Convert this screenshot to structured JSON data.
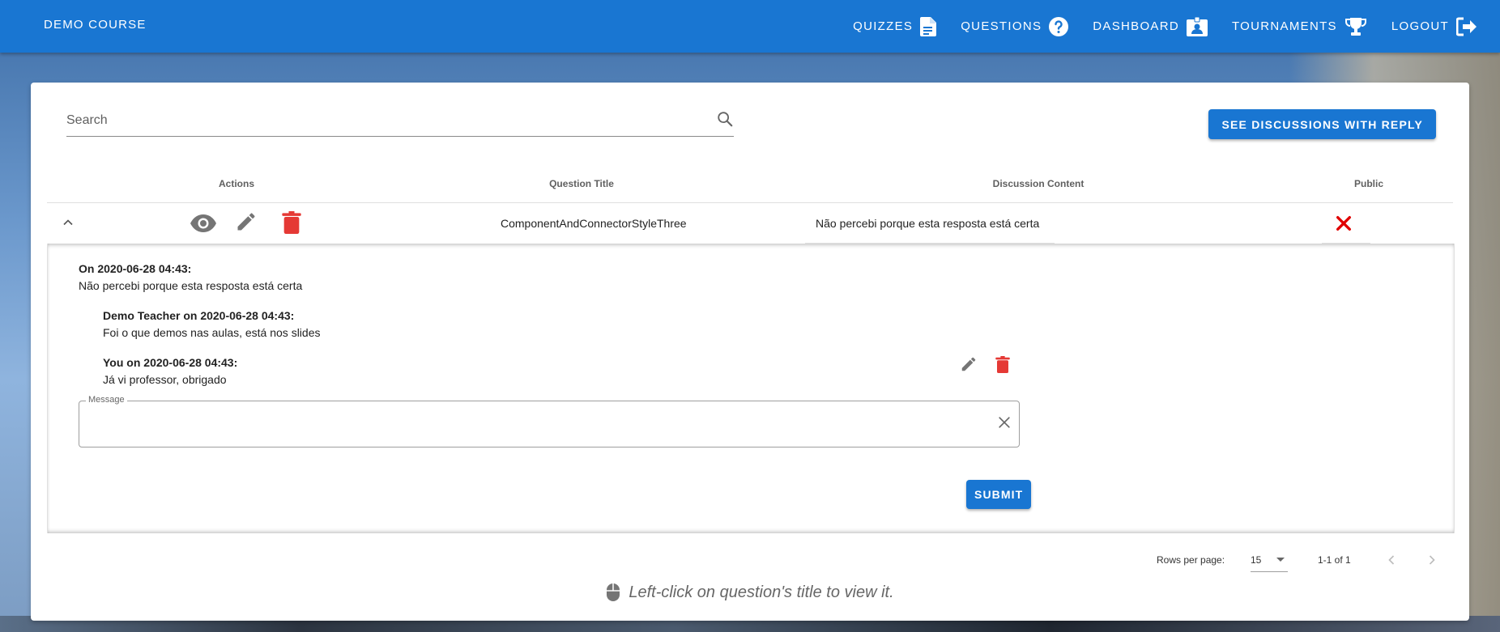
{
  "app": {
    "course_title": "DEMO COURSE"
  },
  "nav": [
    {
      "label": "QUIZZES",
      "icon": "file-document-icon"
    },
    {
      "label": "QUESTIONS",
      "icon": "help-circle-icon"
    },
    {
      "label": "DASHBOARD",
      "icon": "id-card-icon"
    },
    {
      "label": "TOURNAMENTS",
      "icon": "trophy-icon"
    },
    {
      "label": "LOGOUT",
      "icon": "logout-icon"
    }
  ],
  "search": {
    "placeholder": "Search",
    "value": ""
  },
  "see_discussions_button": "SEE DISCUSSIONS WITH REPLY",
  "table": {
    "headers": [
      "Actions",
      "Question Title",
      "Discussion Content",
      "Public"
    ],
    "rows": [
      {
        "question_title": "ComponentAndConnectorStyleThree",
        "discussion_content": "Não percebi porque esta resposta está certa",
        "public": false
      }
    ]
  },
  "discussion": {
    "messages": [
      {
        "author": "On 2020-06-28 04:43:",
        "text": "Não percebi porque esta resposta está certa"
      },
      {
        "author": "Demo Teacher on 2020-06-28 04:43:",
        "text": "Foi o que demos nas aulas, está nos slides"
      },
      {
        "author": "You on 2020-06-28 04:43:",
        "text": "Já vi professor, obrigado"
      }
    ],
    "message_field": {
      "label": "Message",
      "value": ""
    },
    "submit_label": "SUBMIT"
  },
  "pagination": {
    "rows_per_page_label": "Rows per page:",
    "rows_per_page_value": "15",
    "range_text": "1-1 of 1"
  },
  "tip": "Left-click on question's title to view it.",
  "colors": {
    "primary": "#1976d2",
    "danger": "#e53935",
    "icon_grey": "#757575"
  }
}
